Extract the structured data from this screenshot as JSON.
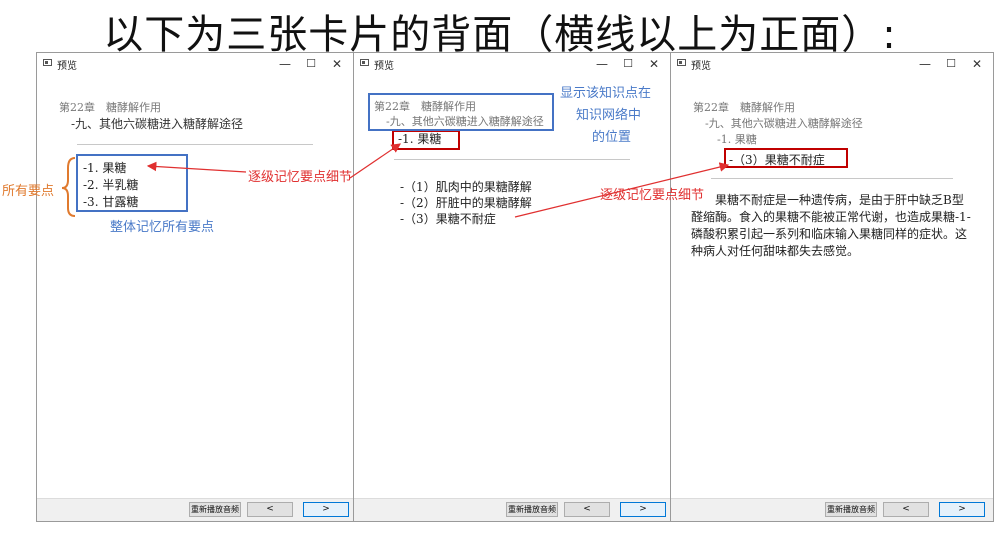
{
  "heading": "以下为三张卡片的背面（横线以上为正面）:",
  "windows": [
    {
      "title": "预览",
      "controls": {
        "minimize": "—",
        "maximize": "☐",
        "close": "✕"
      },
      "chapter": "第22章　糖酵解作用",
      "section": "-九、其他六碳糖进入糖酵解途径",
      "items": [
        "-1.  果糖",
        "-2.  半乳糖",
        "-3.  甘露糖"
      ],
      "buttons": {
        "replay": "重新播放音频",
        "prev": "<",
        "next": ">"
      }
    },
    {
      "title": "预览",
      "controls": {
        "minimize": "—",
        "maximize": "☐",
        "close": "✕"
      },
      "chapter": "第22章　糖酵解作用",
      "section": "-九、其他六碳糖进入糖酵解途径",
      "focus": "-1.  果糖",
      "items": [
        "-（1）肌肉中的果糖酵解",
        "-（2）肝脏中的果糖酵解",
        "-（3）果糖不耐症"
      ],
      "buttons": {
        "replay": "重新播放音频",
        "prev": "<",
        "next": ">"
      }
    },
    {
      "title": "预览",
      "controls": {
        "minimize": "—",
        "maximize": "☐",
        "close": "✕"
      },
      "chapter": "第22章　糖酵解作用",
      "section": "-九、其他六碳糖进入糖酵解途径",
      "sub": "-1. 果糖",
      "focus": "-（3）果糖不耐症",
      "paragraph": "　　果糖不耐症是一种遗传病，是由于肝中缺乏B型醛缩酶。食入的果糖不能被正常代谢，也造成果糖-1-磷酸积累引起一系列和临床输入果糖同样的症状。这种病人对任何甜味都失去感觉。",
      "buttons": {
        "replay": "重新播放音频",
        "prev": "<",
        "next": ">"
      }
    }
  ],
  "annotations": {
    "all_points": "所有要点",
    "overall_memory": "整体记忆所有要点",
    "stepwise_1": "逐级记忆要点细节",
    "stepwise_2": "逐级记忆要点细节",
    "network_position_1": "显示该知识点在",
    "network_position_2": "知识网络中",
    "network_position_3": "的位置"
  },
  "colors": {
    "annotation_red": "#e03030",
    "annotation_blue": "#4a7ac8",
    "annotation_orange": "#e07a2e",
    "box_blue": "#4472c4",
    "box_red": "#c00000"
  }
}
